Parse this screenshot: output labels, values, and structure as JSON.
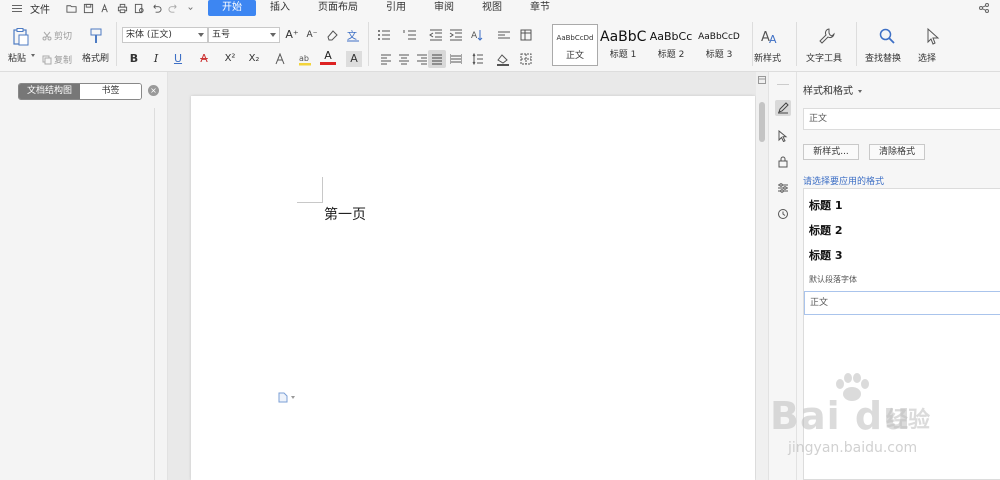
{
  "menubar": {
    "file_label": "文件",
    "tabs": [
      {
        "label": "开始",
        "active": true
      },
      {
        "label": "插入",
        "active": false
      },
      {
        "label": "页面布局",
        "active": false
      },
      {
        "label": "引用",
        "active": false
      },
      {
        "label": "审阅",
        "active": false
      },
      {
        "label": "视图",
        "active": false
      },
      {
        "label": "章节",
        "active": false
      }
    ]
  },
  "ribbon": {
    "paste_label": "粘贴",
    "cut_label": "剪切",
    "copy_label": "复制",
    "format_painter_label": "格式刷",
    "font_name": "宋体 (正文)",
    "font_size": "五号",
    "bold": "B",
    "italic": "I",
    "underline": "U",
    "strike": "A",
    "superscript": "X²",
    "subscript": "X₂",
    "font_color": "A",
    "char_shading": "A",
    "grow_font": "A⁺",
    "shrink_font": "A⁻",
    "styles": [
      {
        "preview": "AaBbCcDd",
        "name": "正文"
      },
      {
        "preview": "AaBbC",
        "name": "标题 1"
      },
      {
        "preview": "AaBbCc",
        "name": "标题 2"
      },
      {
        "preview": "AaBbCcD",
        "name": "标题 3"
      }
    ],
    "new_style_label": "新样式",
    "text_tools_label": "文字工具",
    "find_replace_label": "查找替换",
    "select_label": "选择",
    "accent_color": "#3d86f2"
  },
  "navpane": {
    "tab_outline": "文档结构图",
    "tab_bookmark": "书签"
  },
  "document": {
    "text": "第一页"
  },
  "stylepane": {
    "title": "样式和格式",
    "current_style": "正文",
    "new_style_btn": "新样式...",
    "clear_format_btn": "清除格式",
    "hint": "请选择要应用的格式",
    "items": [
      "标题 1",
      "标题 2",
      "标题 3"
    ],
    "default_font": "默认段落字体",
    "selected_item": "正文"
  },
  "watermark": {
    "brand": "Bai du",
    "cn": "经验",
    "url": "jingyan.baidu.com"
  }
}
